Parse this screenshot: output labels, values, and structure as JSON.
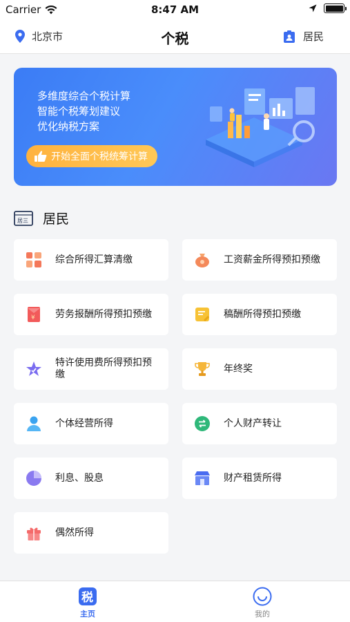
{
  "status_bar": {
    "carrier": "Carrier",
    "time": "8:47 AM"
  },
  "nav": {
    "location": "北京市",
    "title": "个税",
    "identity": "居民"
  },
  "banner": {
    "lines": [
      "多维度综合个税计算",
      "智能个税筹划建议",
      "优化纳税方案"
    ],
    "button_label": "开始全面个税统筹计算"
  },
  "section": {
    "title": "居民",
    "icon_text": "居三"
  },
  "items": [
    {
      "label": "综合所得汇算清缴",
      "icon": "grid-blocks-icon",
      "color": "#f4785a"
    },
    {
      "label": "工资薪金所得预扣预缴",
      "icon": "money-bag-icon",
      "color": "#f4895a"
    },
    {
      "label": "劳务报酬所得预扣预缴",
      "icon": "red-envelope-icon",
      "color": "#f25a5a"
    },
    {
      "label": "稿酬所得预扣预缴",
      "icon": "note-icon",
      "color": "#f7c235"
    },
    {
      "label": "特许使用费所得预扣预缴",
      "icon": "star-icon",
      "color": "#7a6cf0"
    },
    {
      "label": "年终奖",
      "icon": "trophy-icon",
      "color": "#f5b63a"
    },
    {
      "label": "个体经营所得",
      "icon": "person-icon",
      "color": "#3aa3f0"
    },
    {
      "label": "个人财产转让",
      "icon": "transfer-icon",
      "color": "#2fb87a"
    },
    {
      "label": "利息、股息",
      "icon": "pie-icon",
      "color": "#8a7af0"
    },
    {
      "label": "财产租赁所得",
      "icon": "shop-icon",
      "color": "#4a6cf0"
    },
    {
      "label": "偶然所得",
      "icon": "gift-icon",
      "color": "#f46a6a"
    }
  ],
  "tabs": {
    "home": "主页",
    "home_icon_text": "税",
    "mine": "我的"
  }
}
